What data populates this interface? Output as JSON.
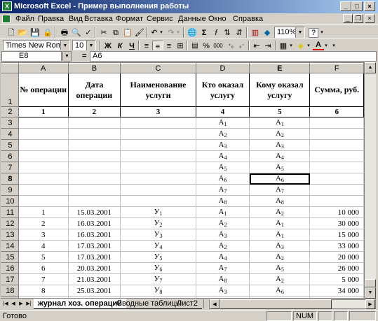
{
  "window": {
    "title": "Microsoft Excel - Пример выполнения работы",
    "min": "_",
    "max": "□",
    "close": "×"
  },
  "menu": [
    "Файл",
    "Правка",
    "Вид",
    "Вставка",
    "Формат",
    "Сервис",
    "Данные",
    "Окно",
    "Справка"
  ],
  "toolbar": {
    "zoom": "110%",
    "help": "?"
  },
  "format_toolbar": {
    "font": "Times New Roman",
    "size": "10",
    "bold": "Ж",
    "italic": "К",
    "underline": "Ч",
    "percent": "%",
    "thousands": "000"
  },
  "formula_bar": {
    "name_box": "E8",
    "eq": "=",
    "formula": "A6"
  },
  "columns": [
    "A",
    "B",
    "C",
    "D",
    "E",
    "F"
  ],
  "header": {
    "a": "№ операции",
    "b": "Дата операции",
    "c": "Наименование услуги",
    "d": "Кто оказал услугу",
    "e": "Кому оказал услугу",
    "f": "Сумма, руб."
  },
  "numbers": [
    "1",
    "2",
    "3",
    "4",
    "5",
    "6"
  ],
  "rows": [
    {
      "n": "3",
      "a": "",
      "b": "",
      "c": "",
      "d": "А",
      "ds": "1",
      "e": "А",
      "es": "1",
      "f": ""
    },
    {
      "n": "4",
      "a": "",
      "b": "",
      "c": "",
      "d": "А",
      "ds": "2",
      "e": "А",
      "es": "2",
      "f": ""
    },
    {
      "n": "5",
      "a": "",
      "b": "",
      "c": "",
      "d": "А",
      "ds": "3",
      "e": "А",
      "es": "3",
      "f": ""
    },
    {
      "n": "6",
      "a": "",
      "b": "",
      "c": "",
      "d": "А",
      "ds": "4",
      "e": "А",
      "es": "4",
      "f": ""
    },
    {
      "n": "7",
      "a": "",
      "b": "",
      "c": "",
      "d": "А",
      "ds": "5",
      "e": "А",
      "es": "5",
      "f": ""
    },
    {
      "n": "8",
      "a": "",
      "b": "",
      "c": "",
      "d": "А",
      "ds": "6",
      "e": "А",
      "es": "6",
      "f": ""
    },
    {
      "n": "9",
      "a": "",
      "b": "",
      "c": "",
      "d": "А",
      "ds": "7",
      "e": "А",
      "es": "7",
      "f": ""
    },
    {
      "n": "10",
      "a": "",
      "b": "",
      "c": "",
      "d": "А",
      "ds": "8",
      "e": "А",
      "es": "8",
      "f": ""
    },
    {
      "n": "11",
      "a": "1",
      "b": "15.03.2001",
      "c": "У",
      "cs": "1",
      "d": "А",
      "ds": "1",
      "e": "А",
      "es": "2",
      "f": "10 000"
    },
    {
      "n": "12",
      "a": "2",
      "b": "16.03.2001",
      "c": "У",
      "cs": "2",
      "d": "А",
      "ds": "2",
      "e": "А",
      "es": "1",
      "f": "30 000"
    },
    {
      "n": "13",
      "a": "3",
      "b": "16.03.2001",
      "c": "У",
      "cs": "3",
      "d": "А",
      "ds": "3",
      "e": "А",
      "es": "1",
      "f": "15 000"
    },
    {
      "n": "14",
      "a": "4",
      "b": "17.03.2001",
      "c": "У",
      "cs": "4",
      "d": "А",
      "ds": "2",
      "e": "А",
      "es": "3",
      "f": "33 000"
    },
    {
      "n": "15",
      "a": "5",
      "b": "17.03.2001",
      "c": "У",
      "cs": "5",
      "d": "А",
      "ds": "4",
      "e": "А",
      "es": "2",
      "f": "20 000"
    },
    {
      "n": "16",
      "a": "6",
      "b": "20.03.2001",
      "c": "У",
      "cs": "6",
      "d": "А",
      "ds": "7",
      "e": "А",
      "es": "5",
      "f": "26 000"
    },
    {
      "n": "17",
      "a": "7",
      "b": "21.03.2001",
      "c": "У",
      "cs": "7",
      "d": "А",
      "ds": "8",
      "e": "А",
      "es": "2",
      "f": "5 000"
    },
    {
      "n": "18",
      "a": "8",
      "b": "25.03.2001",
      "c": "У",
      "cs": "8",
      "d": "А",
      "ds": "3",
      "e": "А",
      "es": "6",
      "f": "34 000"
    },
    {
      "n": "19",
      "a": "9",
      "b": "26.03.2001",
      "c": "У",
      "cs": "9",
      "d": "А",
      "ds": "2",
      "e": "А",
      "es": "7",
      "f": "8 000"
    }
  ],
  "sheets": [
    "журнал хоз. операций",
    "Сводные таблицы",
    "Лист2"
  ],
  "status": {
    "ready": "Готово",
    "num": "NUM"
  }
}
